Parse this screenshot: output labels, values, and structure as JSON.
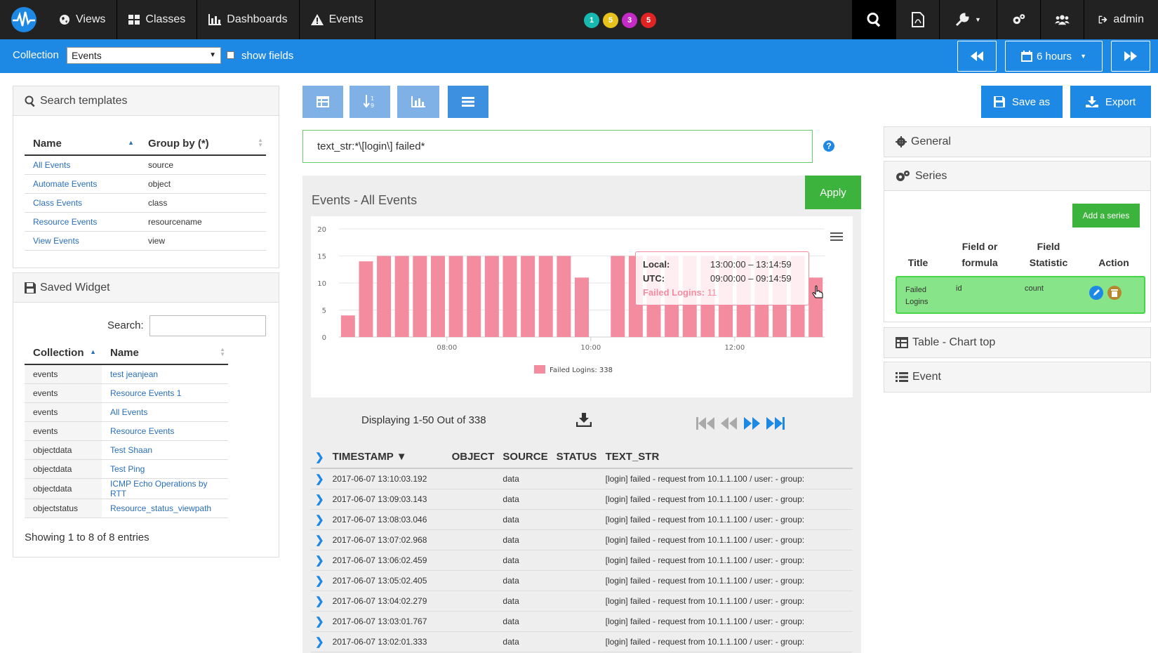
{
  "nav": {
    "items": [
      {
        "label": "Views",
        "icon": "globe-icon"
      },
      {
        "label": "Classes",
        "icon": "grid-icon"
      },
      {
        "label": "Dashboards",
        "icon": "bar-chart-icon"
      },
      {
        "label": "Events",
        "icon": "warning-icon"
      }
    ],
    "badges": [
      {
        "value": "1",
        "color": "#17b8b0"
      },
      {
        "value": "5",
        "color": "#e8c21c"
      },
      {
        "value": "3",
        "color": "#c42ac4"
      },
      {
        "value": "5",
        "color": "#e02424"
      }
    ],
    "user_label": "admin"
  },
  "collection_bar": {
    "label": "Collection",
    "selected": "Events",
    "show_fields_label": "show fields",
    "time_range_label": "6 hours"
  },
  "search_templates": {
    "title": "Search templates",
    "columns": [
      "Name",
      "Group by (*)"
    ],
    "rows": [
      {
        "name": "All Events",
        "group_by": "source"
      },
      {
        "name": "Automate Events",
        "group_by": "object"
      },
      {
        "name": "Class Events",
        "group_by": "class"
      },
      {
        "name": "Resource Events",
        "group_by": "resourcename"
      },
      {
        "name": "View Events",
        "group_by": "view"
      }
    ]
  },
  "saved_widget": {
    "title": "Saved Widget",
    "search_label": "Search:",
    "columns": [
      "Collection",
      "Name"
    ],
    "rows": [
      {
        "collection": "events",
        "name": "test jeanjean"
      },
      {
        "collection": "events",
        "name": "Resource Events 1"
      },
      {
        "collection": "events",
        "name": "All Events"
      },
      {
        "collection": "events",
        "name": "Resource Events"
      },
      {
        "collection": "objectdata",
        "name": "Test Shaan"
      },
      {
        "collection": "objectdata",
        "name": "Test Ping"
      },
      {
        "collection": "objectdata",
        "name": "ICMP Echo Operations by RTT"
      },
      {
        "collection": "objectstatus",
        "name": "Resource_status_viewpath"
      }
    ],
    "footer": "Showing 1 to 8 of 8 entries"
  },
  "toolbar": {
    "save_as_label": "Save as",
    "export_label": "Export"
  },
  "query": {
    "value": "text_str:*\\[login\\] failed*",
    "help": "?"
  },
  "chart_panel": {
    "title": "Events - All Events",
    "apply_label": "Apply",
    "tooltip": {
      "local_label": "Local:",
      "local_value": "13:00:00 – 13:14:59",
      "utc_label": "UTC:",
      "utc_value": "09:00:00 – 09:14:59",
      "series_label": "Failed Logins:",
      "series_value": "11"
    },
    "displaying": "Displaying 1-50 Out of 338"
  },
  "chart_data": {
    "type": "bar",
    "title": "",
    "xlabel": "",
    "ylabel": "",
    "ylim": [
      0,
      20
    ],
    "yticks": [
      0,
      5,
      10,
      15,
      20
    ],
    "xticks": [
      "08:00",
      "10:00",
      "12:00"
    ],
    "legend": "Failed Logins: 338",
    "color": "#f48ca0",
    "series": [
      {
        "name": "Failed Logins",
        "values": [
          4,
          14,
          15,
          15,
          15,
          15,
          15,
          15,
          15,
          15,
          15,
          15,
          15,
          11,
          0,
          15,
          15,
          15,
          15,
          15,
          15,
          15,
          15,
          15,
          15,
          15,
          11
        ]
      }
    ]
  },
  "events_table": {
    "columns": [
      "TIMESTAMP ▼",
      "OBJECT",
      "SOURCE",
      "STATUS",
      "TEXT_STR"
    ],
    "rows": [
      {
        "timestamp": "2017-06-07 13:10:03.192",
        "object": "",
        "source": "data",
        "status": "",
        "text": "[login] failed - request from 10.1.1.100 / user:  - group:"
      },
      {
        "timestamp": "2017-06-07 13:09:03.143",
        "object": "",
        "source": "data",
        "status": "",
        "text": "[login] failed - request from 10.1.1.100 / user:  - group:"
      },
      {
        "timestamp": "2017-06-07 13:08:03.046",
        "object": "",
        "source": "data",
        "status": "",
        "text": "[login] failed - request from 10.1.1.100 / user:  - group:"
      },
      {
        "timestamp": "2017-06-07 13:07:02.968",
        "object": "",
        "source": "data",
        "status": "",
        "text": "[login] failed - request from 10.1.1.100 / user:  - group:"
      },
      {
        "timestamp": "2017-06-07 13:06:02.459",
        "object": "",
        "source": "data",
        "status": "",
        "text": "[login] failed - request from 10.1.1.100 / user:  - group:"
      },
      {
        "timestamp": "2017-06-07 13:05:02.405",
        "object": "",
        "source": "data",
        "status": "",
        "text": "[login] failed - request from 10.1.1.100 / user:  - group:"
      },
      {
        "timestamp": "2017-06-07 13:04:02.279",
        "object": "",
        "source": "data",
        "status": "",
        "text": "[login] failed - request from 10.1.1.100 / user:  - group:"
      },
      {
        "timestamp": "2017-06-07 13:03:01.767",
        "object": "",
        "source": "data",
        "status": "",
        "text": "[login] failed - request from 10.1.1.100 / user:  - group:"
      },
      {
        "timestamp": "2017-06-07 13:02:01.333",
        "object": "",
        "source": "data",
        "status": "",
        "text": "[login] failed - request from 10.1.1.100 / user:  - group:"
      }
    ]
  },
  "right_panel": {
    "general_label": "General",
    "series_label": "Series",
    "add_series_label": "Add a series",
    "series_columns": {
      "title": "Title",
      "field": "Field or formula",
      "statistic": "Field Statistic",
      "action": "Action"
    },
    "series_row": {
      "title": "Failed Logins",
      "field": "id",
      "statistic": "count"
    },
    "table_chart_label": "Table - Chart top",
    "event_label": "Event"
  }
}
